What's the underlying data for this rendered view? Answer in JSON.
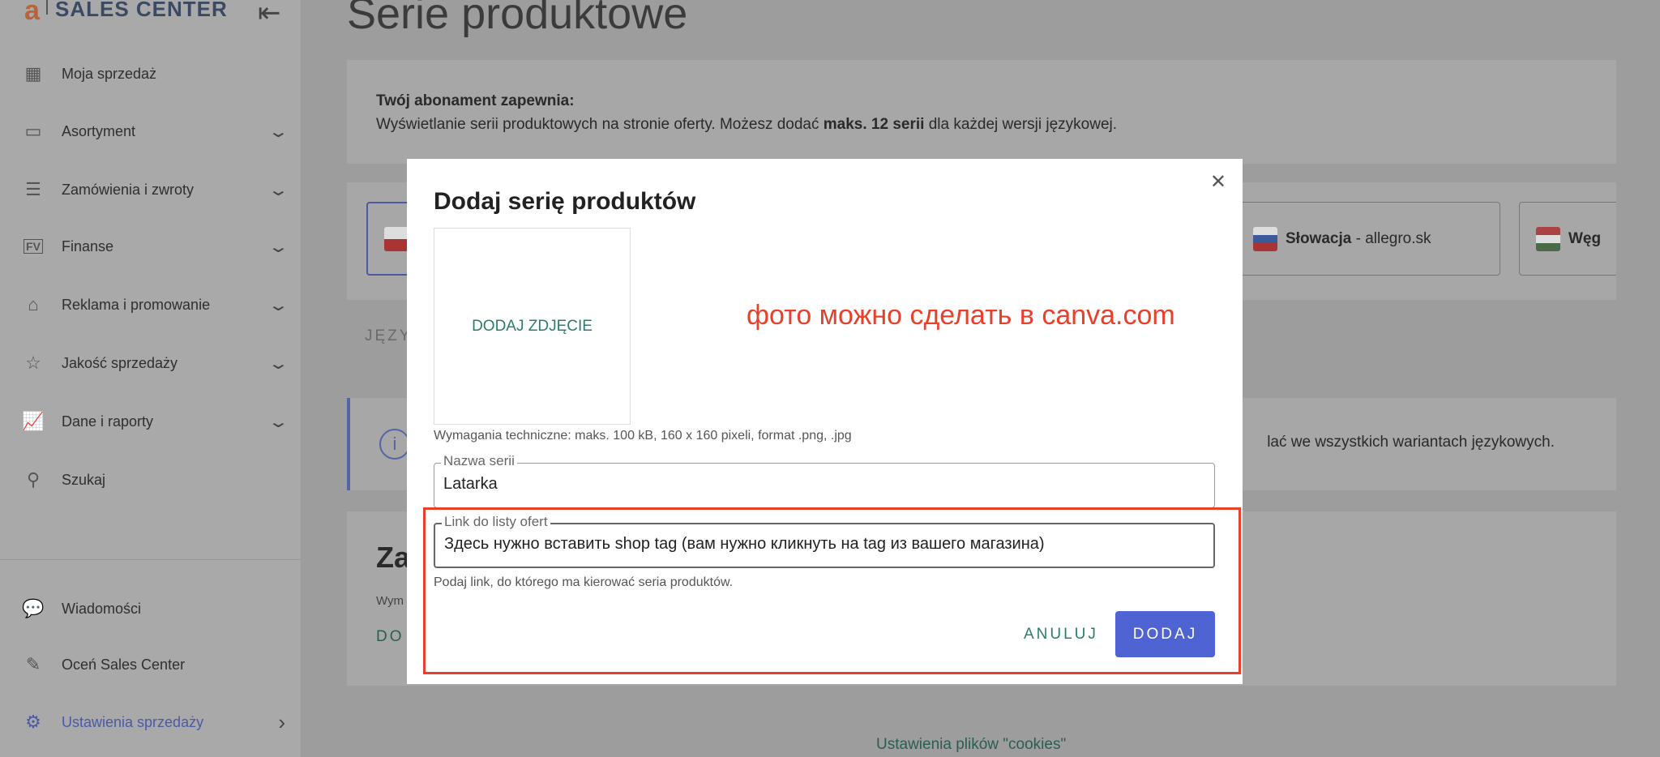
{
  "sidebar": {
    "logo_letter": "a",
    "logo_text": "SALES CENTER",
    "items": [
      {
        "label": "Moja sprzedaż",
        "icon": "grid-icon",
        "chevron": false
      },
      {
        "label": "Asortyment",
        "icon": "box-icon",
        "chevron": true
      },
      {
        "label": "Zamówienia i zwroty",
        "icon": "receipt-icon",
        "chevron": true
      },
      {
        "label": "Finanse",
        "icon": "invoice-icon",
        "chevron": true
      },
      {
        "label": "Reklama i promowanie",
        "icon": "tag-icon",
        "chevron": true
      },
      {
        "label": "Jakość sprzedaży",
        "icon": "star-icon",
        "chevron": true
      },
      {
        "label": "Dane i raporty",
        "icon": "chart-icon",
        "chevron": true
      },
      {
        "label": "Szukaj",
        "icon": "search-icon",
        "chevron": false
      }
    ],
    "bottom_items": [
      {
        "label": "Wiadomości",
        "icon": "chat-icon"
      },
      {
        "label": "Oceń Sales Center",
        "icon": "edit-icon"
      },
      {
        "label": "Ustawienia sprzedaży",
        "icon": "gear-icon",
        "active": true
      }
    ]
  },
  "page": {
    "title": "Serie produktowe",
    "subscription_heading": "Twój abonament zapewnia:",
    "subscription_text_1": "Wyświetlanie serii produktowych na stronie oferty. Możesz dodać ",
    "subscription_bold": "maks. 12 serii",
    "subscription_text_2": " dla każdej wersji językowej.",
    "tabs": [
      {
        "country": "Słowacja",
        "domain": " - allegro.sk"
      },
      {
        "country": "Węg"
      }
    ],
    "lang_label": "JĘZY",
    "info_text": "lać we wszystkich wariantach językowych.",
    "section_heading": "Za",
    "section_sub": "Wym",
    "section_link": "DO",
    "footer_link": "Ustawienia plików \"cookies\""
  },
  "modal": {
    "title": "Dodaj serię produktów",
    "close": "✕",
    "add_photo": "DODAJ ZDJĘCIE",
    "annotation": "фото можно сделать в canva.com",
    "annotation_color": "#e8402a",
    "requirements": "Wymagania techniczne: maks. 100 kB, 160 x 160 pixeli, format .png, .jpg",
    "name_label": "Nazwa serii",
    "name_value": "Latarka",
    "link_label": "Link do listy ofert",
    "link_value": "Здесь нужно вставить shop tag (вам нужно кликнуть на tag из вашего магазина)",
    "link_helper": "Podaj link, do którego ma kierować seria produktów.",
    "cancel": "ANULUJ",
    "submit": "DODAJ",
    "accent": "#4f63d2"
  }
}
